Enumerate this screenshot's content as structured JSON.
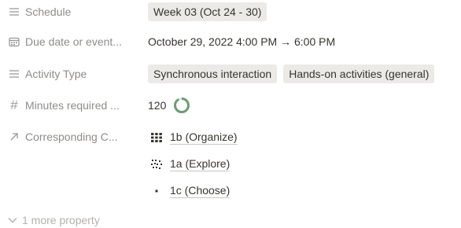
{
  "properties": {
    "schedule": {
      "label": "Schedule",
      "value": "Week 03 (Oct 24 - 30)",
      "icon": "list-icon"
    },
    "due": {
      "label": "Due date or event...",
      "value": "October 29, 2022 4:00 PM → 6:00 PM",
      "icon": "calendar-icon"
    },
    "activity": {
      "label": "Activity Type",
      "tags": [
        "Synchronous interaction",
        "Hands-on activities (general)"
      ],
      "icon": "list-icon"
    },
    "minutes": {
      "label": "Minutes required ...",
      "value": "120",
      "progress": 0.92,
      "ring_color": "#6f9a76",
      "icon": "hash-icon"
    },
    "corresponding": {
      "label": "Corresponding C...",
      "icon": "relation-arrow-icon",
      "items": [
        {
          "label": "1b (Organize)",
          "icon": "grid-icon"
        },
        {
          "label": "1a (Explore)",
          "icon": "scatter-icon"
        },
        {
          "label": "1c (Choose)",
          "icon": "dot-icon"
        }
      ]
    }
  },
  "more": {
    "label": "1 more property",
    "icon": "chevron-down-icon"
  }
}
